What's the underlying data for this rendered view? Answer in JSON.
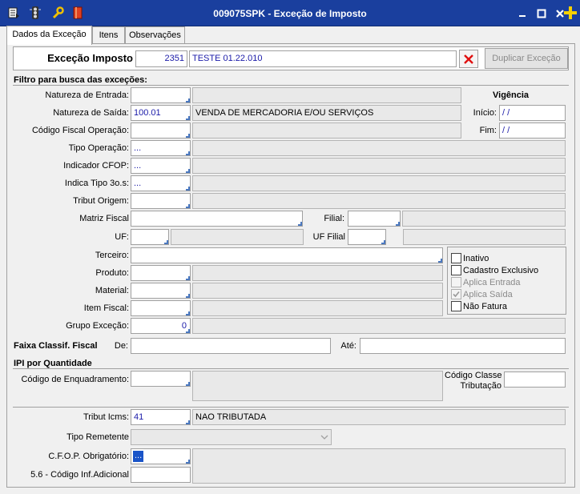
{
  "window": {
    "title": "009075SPK - Exceção de Imposto"
  },
  "toolbar_icons": [
    "menu-icon",
    "traffic-light-icon",
    "wrench-icon",
    "book-icon"
  ],
  "window_buttons": [
    "minimize-icon",
    "maximize-icon",
    "close-icon",
    "add-icon"
  ],
  "tabs": [
    {
      "label": "Dados da Exceção",
      "active": true
    },
    {
      "label": "Itens",
      "active": false
    },
    {
      "label": "Observações",
      "active": false
    }
  ],
  "header": {
    "label": "Exceção Imposto",
    "code": "2351",
    "description": "TESTE 01.22.010",
    "duplicate_button": "Duplicar Exceção"
  },
  "filtro": {
    "title": "Filtro para busca das exceções:",
    "natureza_entrada": {
      "label": "Natureza de Entrada:",
      "value": "",
      "desc": ""
    },
    "natureza_saida": {
      "label": "Natureza de Saída:",
      "value": "100.01",
      "desc": "VENDA DE MERCADORIA E/OU SERVIÇOS"
    },
    "codigo_fiscal": {
      "label": "Código Fiscal Operação:",
      "value": "",
      "desc": ""
    },
    "tipo_operacao": {
      "label": "Tipo Operação:",
      "value": "...",
      "desc": ""
    },
    "indicador_cfop": {
      "label": "Indicador CFOP:",
      "value": "...",
      "desc": ""
    },
    "indica_tipo": {
      "label": "Indica Tipo 3o.s:",
      "value": "...",
      "desc": ""
    },
    "tribut_origem": {
      "label": "Tribut Origem:",
      "value": "",
      "desc": ""
    },
    "matriz_fiscal": {
      "label": "Matriz Fiscal",
      "value": ""
    },
    "filial": {
      "label": "Filial:",
      "value": "",
      "desc": ""
    },
    "uf": {
      "label": "UF:",
      "value": "",
      "desc": ""
    },
    "uf_filial": {
      "label": "UF Filial",
      "value": "",
      "desc": ""
    },
    "terceiro": {
      "label": "Terceiro:",
      "value": ""
    },
    "produto": {
      "label": "Produto:",
      "value": "",
      "desc": ""
    },
    "material": {
      "label": "Material:",
      "value": "",
      "desc": ""
    },
    "item_fiscal": {
      "label": "Item Fiscal:",
      "value": "",
      "desc": ""
    },
    "grupo_excecao": {
      "label": "Grupo Exceção:",
      "value": "0",
      "desc": ""
    }
  },
  "vigencia": {
    "title": "Vigência",
    "inicio_label": "Início:",
    "inicio_value": " / /",
    "fim_label": "Fim:",
    "fim_value": " / /"
  },
  "checkboxes": [
    {
      "label": "Inativo",
      "checked": false,
      "disabled": false
    },
    {
      "label": "Cadastro Exclusivo",
      "checked": false,
      "disabled": false
    },
    {
      "label": "Aplica Entrada",
      "checked": false,
      "disabled": true
    },
    {
      "label": "Aplica Saída",
      "checked": true,
      "disabled": true
    },
    {
      "label": "Não Fatura",
      "checked": false,
      "disabled": false
    }
  ],
  "faixa": {
    "title": "Faixa Classif. Fiscal",
    "de_label": "De:",
    "de_value": "",
    "ate_label": "Até:",
    "ate_value": ""
  },
  "ipi": {
    "title": "IPI por Quantidade",
    "enquadramento_label": "Código de Enquadramento:",
    "enquadramento_value": "",
    "classe_label_1": "Código Classe",
    "classe_label_2": "Tributação",
    "classe_value": ""
  },
  "tributacao": {
    "tribut_icms": {
      "label": "Tribut Icms:",
      "value": "41",
      "desc": "NAO TRIBUTADA"
    },
    "tipo_remetente": {
      "label": "Tipo Remetente",
      "value": ""
    },
    "cfop_obrigatorio": {
      "label": "C.F.O.P. Obrigatório:",
      "value": "...",
      "desc": ""
    },
    "codigo_inf": {
      "label": "5.6 - Código Inf.Adicional",
      "value": ""
    }
  }
}
